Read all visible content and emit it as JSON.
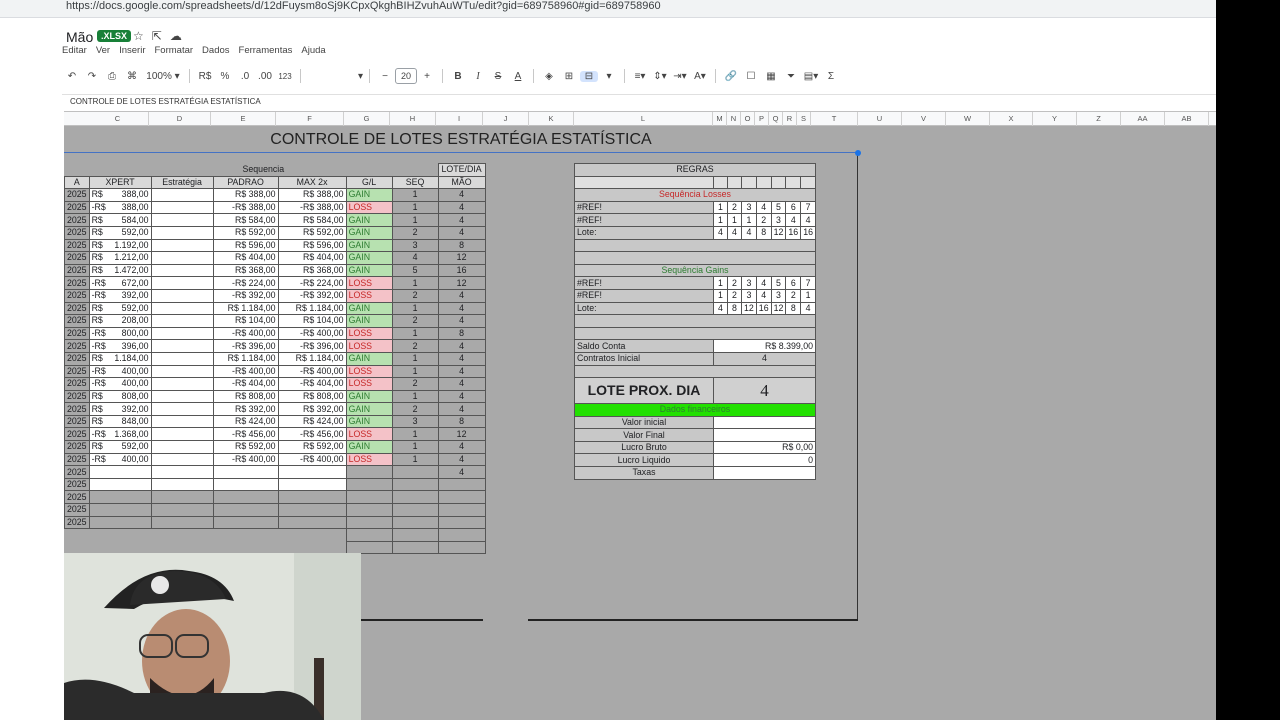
{
  "url": "https://docs.google.com/spreadsheets/d/12dFuysm8oSj9KCpxQkghBIHZvuhAuWTu/edit?gid=689758960#gid=689758960",
  "doc": {
    "title": "Mão",
    "badge": ".XLSX"
  },
  "menu": [
    "Editar",
    "Ver",
    "Inserir",
    "Formatar",
    "Dados",
    "Ferramentas",
    "Ajuda"
  ],
  "toolbar": {
    "zoom": "100%",
    "currency": "R$",
    "percent": "%",
    "dec_less": ".0",
    "dec_more": ".00",
    "format123": "123",
    "font_size": "20"
  },
  "formula_bar": "CONTROLE DE LOTES ESTRATÉGIA ESTATÍSTICA",
  "columns": [
    "C",
    "D",
    "E",
    "F",
    "G",
    "H",
    "I",
    "J",
    "K",
    "L",
    "M",
    "N",
    "O",
    "P",
    "Q",
    "R",
    "S",
    "T",
    "U",
    "V",
    "W",
    "X",
    "Y",
    "Z",
    "AA",
    "AB"
  ],
  "sheet_title": "CONTROLE DE LOTES ESTRATÉGIA ESTATÍSTICA",
  "left": {
    "group_header": "Sequencia",
    "lote_dia": "LOTE/DIA",
    "headers": [
      "A",
      "XPERT",
      "Estratégia",
      "PADRAO",
      "MAX 2x",
      "G/L",
      "SEQ",
      "MÃO"
    ],
    "rows": [
      {
        "a": "2025",
        "xs": "R$",
        "xv": "388,00",
        "e": "R$ 388,00",
        "f": "R$ 388,00",
        "g": "GAIN",
        "h": "1",
        "i": "4"
      },
      {
        "a": "2025",
        "xs": "-R$",
        "xv": "388,00",
        "e": "-R$ 388,00",
        "f": "-R$ 388,00",
        "g": "LOSS",
        "h": "1",
        "i": "4"
      },
      {
        "a": "2025",
        "xs": "R$",
        "xv": "584,00",
        "e": "R$ 584,00",
        "f": "R$ 584,00",
        "g": "GAIN",
        "h": "1",
        "i": "4"
      },
      {
        "a": "2025",
        "xs": "R$",
        "xv": "592,00",
        "e": "R$ 592,00",
        "f": "R$ 592,00",
        "g": "GAIN",
        "h": "2",
        "i": "4"
      },
      {
        "a": "2025",
        "xs": "R$",
        "xv": "1.192,00",
        "e": "R$ 596,00",
        "f": "R$ 596,00",
        "g": "GAIN",
        "h": "3",
        "i": "8"
      },
      {
        "a": "2025",
        "xs": "R$",
        "xv": "1.212,00",
        "e": "R$ 404,00",
        "f": "R$ 404,00",
        "g": "GAIN",
        "h": "4",
        "i": "12"
      },
      {
        "a": "2025",
        "xs": "R$",
        "xv": "1.472,00",
        "e": "R$ 368,00",
        "f": "R$ 368,00",
        "g": "GAIN",
        "h": "5",
        "i": "16"
      },
      {
        "a": "2025",
        "xs": "-R$",
        "xv": "672,00",
        "e": "-R$ 224,00",
        "f": "-R$ 224,00",
        "g": "LOSS",
        "h": "1",
        "i": "12"
      },
      {
        "a": "2025",
        "xs": "-R$",
        "xv": "392,00",
        "e": "-R$ 392,00",
        "f": "-R$ 392,00",
        "g": "LOSS",
        "h": "2",
        "i": "4"
      },
      {
        "a": "2025",
        "xs": "R$",
        "xv": "592,00",
        "e": "R$ 1.184,00",
        "f": "R$ 1.184,00",
        "g": "GAIN",
        "h": "1",
        "i": "4"
      },
      {
        "a": "2025",
        "xs": "R$",
        "xv": "208,00",
        "e": "R$ 104,00",
        "f": "R$ 104,00",
        "g": "GAIN",
        "h": "2",
        "i": "4"
      },
      {
        "a": "2025",
        "xs": "-R$",
        "xv": "800,00",
        "e": "-R$ 400,00",
        "f": "-R$ 400,00",
        "g": "LOSS",
        "h": "1",
        "i": "8"
      },
      {
        "a": "2025",
        "xs": "-R$",
        "xv": "396,00",
        "e": "-R$ 396,00",
        "f": "-R$ 396,00",
        "g": "LOSS",
        "h": "2",
        "i": "4"
      },
      {
        "a": "2025",
        "xs": "R$",
        "xv": "1.184,00",
        "e": "R$ 1.184,00",
        "f": "R$ 1.184,00",
        "g": "GAIN",
        "h": "1",
        "i": "4"
      },
      {
        "a": "2025",
        "xs": "-R$",
        "xv": "400,00",
        "e": "-R$ 400,00",
        "f": "-R$ 400,00",
        "g": "LOSS",
        "h": "1",
        "i": "4"
      },
      {
        "a": "2025",
        "xs": "-R$",
        "xv": "400,00",
        "e": "-R$ 404,00",
        "f": "-R$ 404,00",
        "g": "LOSS",
        "h": "2",
        "i": "4"
      },
      {
        "a": "2025",
        "xs": "R$",
        "xv": "808,00",
        "e": "R$ 808,00",
        "f": "R$ 808,00",
        "g": "GAIN",
        "h": "1",
        "i": "4"
      },
      {
        "a": "2025",
        "xs": "R$",
        "xv": "392,00",
        "e": "R$ 392,00",
        "f": "R$ 392,00",
        "g": "GAIN",
        "h": "2",
        "i": "4"
      },
      {
        "a": "2025",
        "xs": "R$",
        "xv": "848,00",
        "e": "R$ 424,00",
        "f": "R$ 424,00",
        "g": "GAIN",
        "h": "3",
        "i": "8"
      },
      {
        "a": "2025",
        "xs": "-R$",
        "xv": "1.368,00",
        "e": "-R$ 456,00",
        "f": "-R$ 456,00",
        "g": "LOSS",
        "h": "1",
        "i": "12"
      },
      {
        "a": "2025",
        "xs": "R$",
        "xv": "592,00",
        "e": "R$ 592,00",
        "f": "R$ 592,00",
        "g": "GAIN",
        "h": "1",
        "i": "4"
      },
      {
        "a": "2025",
        "xs": "-R$",
        "xv": "400,00",
        "e": "-R$ 400,00",
        "f": "-R$ 400,00",
        "g": "LOSS",
        "h": "1",
        "i": "4"
      },
      {
        "a": "2025",
        "xs": "",
        "xv": "",
        "e": "",
        "f": "",
        "g": "",
        "h": "",
        "i": "4"
      },
      {
        "a": "2025",
        "xs": "",
        "xv": "",
        "e": "",
        "f": "",
        "g": "",
        "h": "",
        "i": ""
      },
      {
        "a": "2025",
        "xs": "",
        "xv": "",
        "e": "",
        "f": "",
        "g": "",
        "h": "",
        "i": ""
      },
      {
        "a": "2025",
        "xs": "",
        "xv": "",
        "e": "",
        "f": "",
        "g": "",
        "h": "",
        "i": ""
      },
      {
        "a": "2025",
        "xs": "",
        "xv": "",
        "e": "",
        "f": "",
        "g": "",
        "h": "",
        "i": ""
      }
    ]
  },
  "right": {
    "regras": "REGRAS",
    "seq_losses": "Sequência Losses",
    "losses_rows": [
      {
        "label": "#REF!",
        "vals": [
          "1",
          "2",
          "3",
          "4",
          "5",
          "6",
          "7"
        ]
      },
      {
        "label": "#REF!",
        "vals": [
          "1",
          "1",
          "1",
          "2",
          "3",
          "4",
          "4"
        ]
      },
      {
        "label": "Lote:",
        "vals": [
          "4",
          "4",
          "4",
          "8",
          "12",
          "16",
          "16"
        ]
      }
    ],
    "seq_gains": "Sequência Gains",
    "gains_rows": [
      {
        "label": "#REF!",
        "vals": [
          "1",
          "2",
          "3",
          "4",
          "5",
          "6",
          "7"
        ]
      },
      {
        "label": "#REF!",
        "vals": [
          "1",
          "2",
          "3",
          "4",
          "3",
          "2",
          "1"
        ]
      },
      {
        "label": "Lote:",
        "vals": [
          "4",
          "8",
          "12",
          "16",
          "12",
          "8",
          "4"
        ]
      }
    ],
    "saldo_label": "Saldo Conta",
    "saldo_value": "R$ 8.399,00",
    "contratos_label": "Contratos Inicial",
    "contratos_value": "4",
    "lote_label": "LOTE PROX. DIA",
    "lote_value": "4",
    "dados_fin": "Dados financeiros",
    "fin_rows": [
      {
        "label": "Valor inicial",
        "value": ""
      },
      {
        "label": "Valor Final",
        "value": ""
      },
      {
        "label": "Lucro Bruto",
        "value": "R$ 0,00"
      },
      {
        "label": "Lucro Liquido",
        "value": "0"
      },
      {
        "label": "Taxas",
        "value": ""
      }
    ]
  }
}
